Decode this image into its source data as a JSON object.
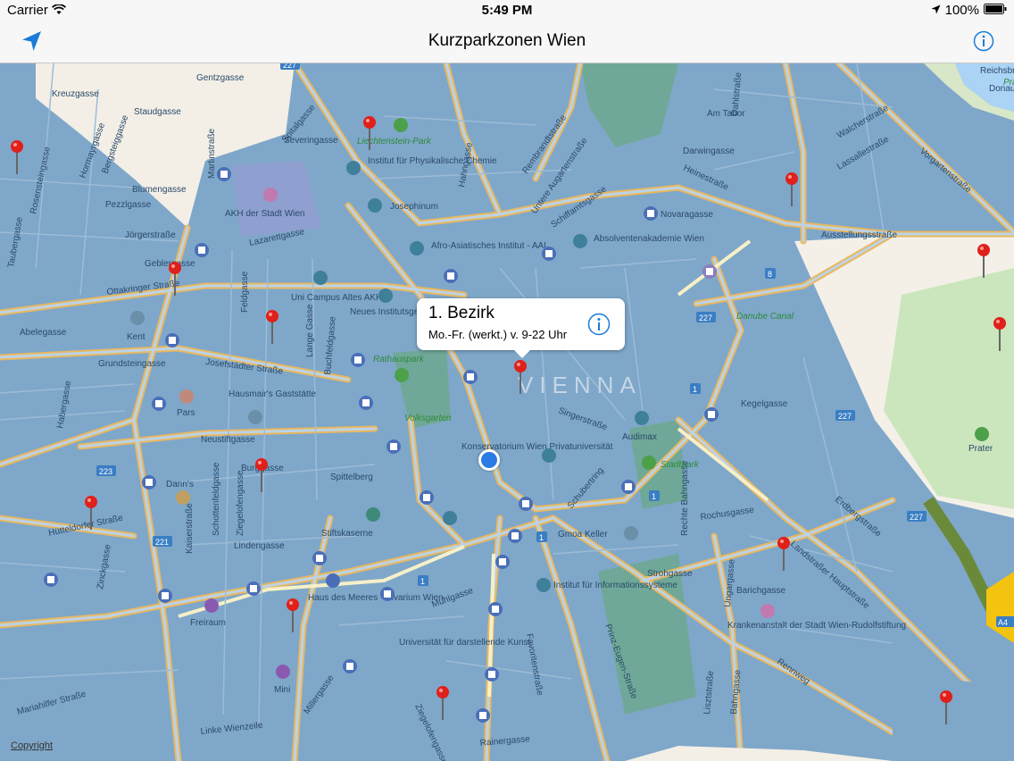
{
  "status_bar": {
    "carrier": "Carrier",
    "time": "5:49 PM",
    "battery": "100%"
  },
  "nav_bar": {
    "title": "Kurzparkzonen Wien",
    "left_icon": "location-arrow-icon",
    "right_icon": "info-icon"
  },
  "callout": {
    "title": "1. Bezirk",
    "subtitle": "Mo.-Fr. (werkt.) v. 9-22 Uhr",
    "icon": "info-icon"
  },
  "map": {
    "city_label": "VIENNA",
    "copyright": "Copyright",
    "street_labels": [
      "Gentzgasse",
      "Kreuzgasse",
      "Staudgasse",
      "Martinstraße",
      "Rosensteingasse",
      "Hormayrgasse",
      "Bergsteiggasse",
      "Blumengasse",
      "Pezzlgasse",
      "Taubergasse",
      "Jörgerstraße",
      "Geblergasse",
      "Ottakringer Straße",
      "Lazarettgasse",
      "AKH der Stadt Wien",
      "Spitalgasse",
      "Severingasse",
      "Institut für Physikalische Chemie",
      "Josephinum",
      "Afro-Asiatisches Institut - AAI",
      "Uni Campus Altes AKH",
      "Neues Institutsgebäude der Uni Wien",
      "Feldgasse",
      "Lange Gasse",
      "Buchfeldgasse",
      "Kent",
      "Abelegasse",
      "Grundsteingasse",
      "Josefstädter Straße",
      "Hausmair's Gaststätte",
      "Pars",
      "Habergasse",
      "Neustiftgasse",
      "Burggasse",
      "Dann's",
      "Schottenfeldgasse",
      "Ziegelofengasse",
      "Kaiserstraße",
      "Spittelberg",
      "Stiftskaserne",
      "Lindengasse",
      "Hütteldorfer Straße",
      "Zinckgasse",
      "Haus des Meeres - Vivarium Wien",
      "Freiraum",
      "Mariahilfer Straße",
      "Mini",
      "Millergasse",
      "Linke Wienzeile",
      "Mühlgasse",
      "Universität für darstellende Kunst",
      "Ziegelofengasse",
      "Rainergasse",
      "Favoritenstraße",
      "Prinz-Eugen-Straße",
      "Institut für Informationssysteme",
      "Gmoa Keller",
      "Konservatorium Wien Privatuniversität",
      "Audimax",
      "Singerstraße",
      "Schubertring",
      "Hahngasse",
      "Rembrandtstraße",
      "Untere Augartenstraße",
      "Schiffamtsgasse",
      "Absolventenakademie Wien",
      "Novaragasse",
      "Heinestraße",
      "Darwingasse",
      "Am Tabor",
      "Walcherstraße",
      "Lassallestraße",
      "Vorgartenstraße",
      "Ausstellungsstraße",
      "Danube Canal",
      "Kegelgasse",
      "Rochusgasse",
      "Barichgasse",
      "Krankenanstalt der Stadt Wien-Rudolfstiftung",
      "Rennweg",
      "Landstraßer Hauptstraße",
      "Erdbergstraße",
      "Strohgasse",
      "Rechte Bahngasse",
      "Ungargasse",
      "Lisztstraße",
      "Bahngasse",
      "Reichsbrücke",
      "Donau",
      "Prater",
      "Dahlstraße"
    ],
    "park_labels": [
      "Liechtenstein-Park",
      "Rathauspark",
      "Volksgarten",
      "Stadtpark",
      "Prater"
    ],
    "route_badges": [
      "227",
      "221",
      "223",
      "227",
      "227",
      "227",
      "8",
      "1",
      "1",
      "1",
      "1",
      "A4"
    ]
  }
}
